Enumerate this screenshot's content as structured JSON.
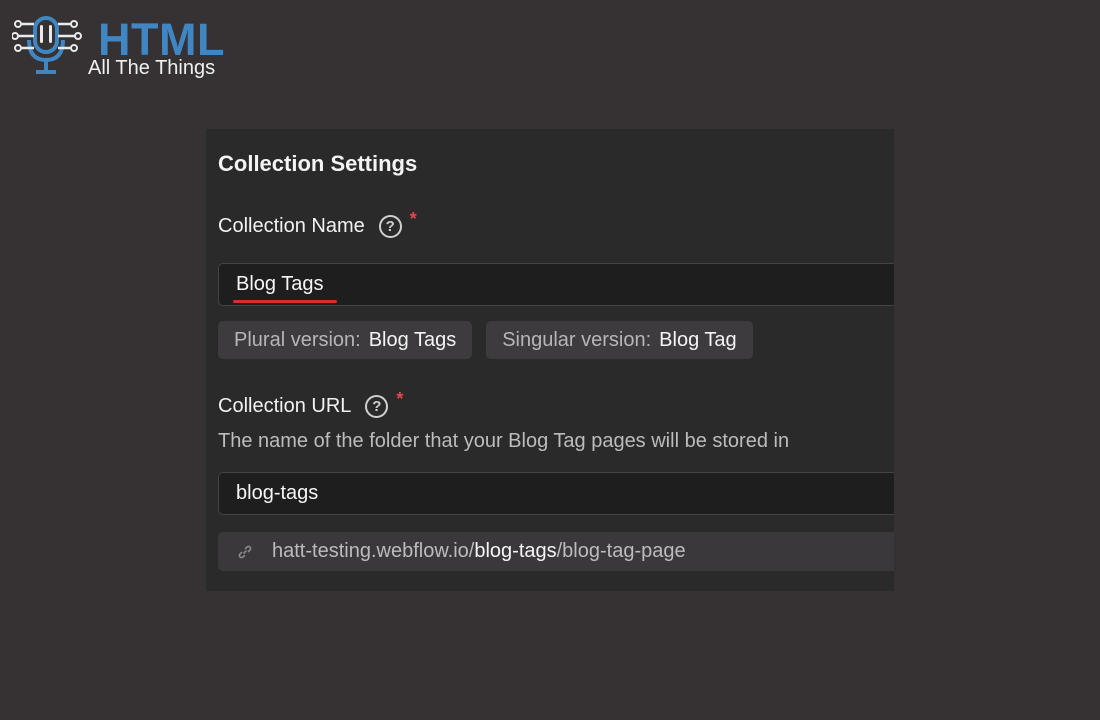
{
  "logo": {
    "title": "HTML",
    "subtitle": "All The Things",
    "brand_color": "#3f86c2"
  },
  "panel": {
    "title": "Collection Settings",
    "collection_name": {
      "label": "Collection Name",
      "help_icon": "?",
      "required_mark": "*",
      "value": "Blog Tags",
      "spellcheck_underline": true
    },
    "plural": {
      "key": "Plural version:",
      "value": "Blog Tags"
    },
    "singular": {
      "key": "Singular version:",
      "value": "Blog Tag"
    },
    "collection_url": {
      "label": "Collection URL",
      "help_icon": "?",
      "required_mark": "*",
      "help_text": "The name of the folder that your Blog Tag pages will be stored in",
      "value": "blog-tags"
    },
    "url_preview": {
      "icon": "link-icon",
      "domain": "hatt-testing.webflow.io/",
      "folder": "blog-tags",
      "page": "/blog-tag-page"
    }
  },
  "colors": {
    "background": "#363234",
    "panel": "#2b2a2b",
    "input": "#1e1e1f",
    "chip": "#3d3b3d",
    "required": "#e0484a",
    "spellcheck": "#d22f2f"
  }
}
